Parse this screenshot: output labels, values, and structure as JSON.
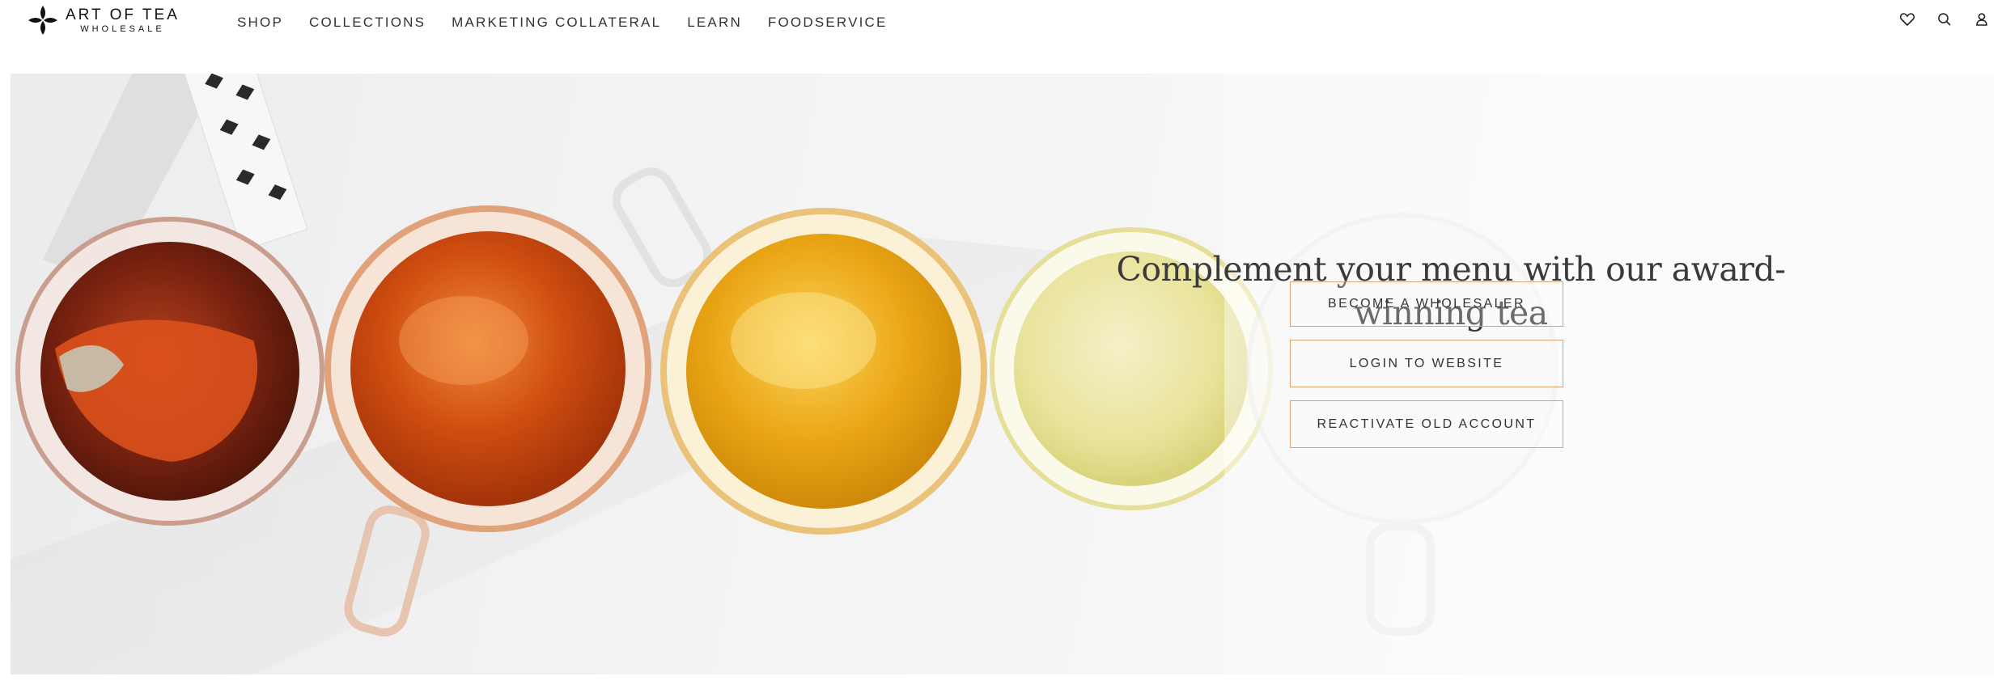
{
  "brand": {
    "title": "ART OF TEA",
    "subtitle": "WHOLESALE"
  },
  "nav": {
    "items": [
      {
        "label": "SHOP"
      },
      {
        "label": "COLLECTIONS"
      },
      {
        "label": "MARKETING COLLATERAL"
      },
      {
        "label": "LEARN"
      },
      {
        "label": "FOODSERVICE"
      }
    ]
  },
  "header_icons": [
    "heart-icon",
    "search-icon",
    "user-icon"
  ],
  "hero": {
    "title": "Complement your menu with our award-winning tea",
    "buttons": {
      "become": "BECOME A WHOLESALER",
      "login": "LOGIN TO WEBSITE",
      "reactivate": "REACTIVATE OLD ACCOUNT"
    }
  },
  "colors": {
    "button_border": "#d9a46f",
    "text_dark": "#333333",
    "tea_dark": "#8a2a10",
    "tea_amber": "#d9590f",
    "tea_gold": "#eaa515",
    "tea_pale": "#e8e39a"
  }
}
